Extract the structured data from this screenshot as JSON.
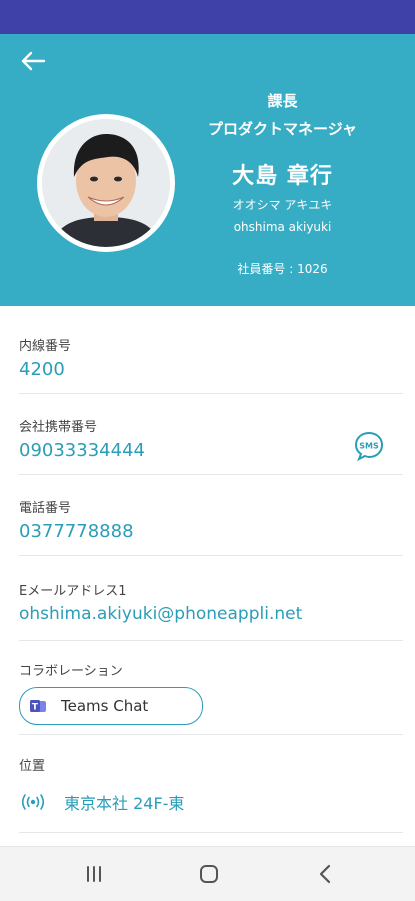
{
  "header": {
    "back_icon": "arrow-left-icon",
    "title": "課長",
    "department": "プロダクトマネージャ",
    "name": "大島 章行",
    "name_kana": "オオシマ アキユキ",
    "name_roman": "ohshima akiyuki",
    "employee_number": "社員番号 : 1026",
    "bg_color": "#36adc4"
  },
  "fields": {
    "extension": {
      "label": "内線番号",
      "value": "4200"
    },
    "mobile": {
      "label": "会社携帯番号",
      "value": "09033334444",
      "sms_icon": "sms-icon"
    },
    "phone": {
      "label": "電話番号",
      "value": "0377778888"
    },
    "email": {
      "label": "Eメールアドレス1",
      "value": "ohshima.akiyuki@phoneappli.net"
    },
    "collaboration": {
      "label": "コラボレーション",
      "button_label": "Teams Chat",
      "button_icon": "teams-icon"
    },
    "location": {
      "label": "位置",
      "value": "東京本社 24F-東",
      "icon": "beacon-icon"
    }
  },
  "navbar": {
    "items": [
      "recent-apps-icon",
      "home-icon",
      "back-icon"
    ]
  },
  "colors": {
    "accent": "#2a9db8",
    "status_bar": "#3f40a8"
  }
}
